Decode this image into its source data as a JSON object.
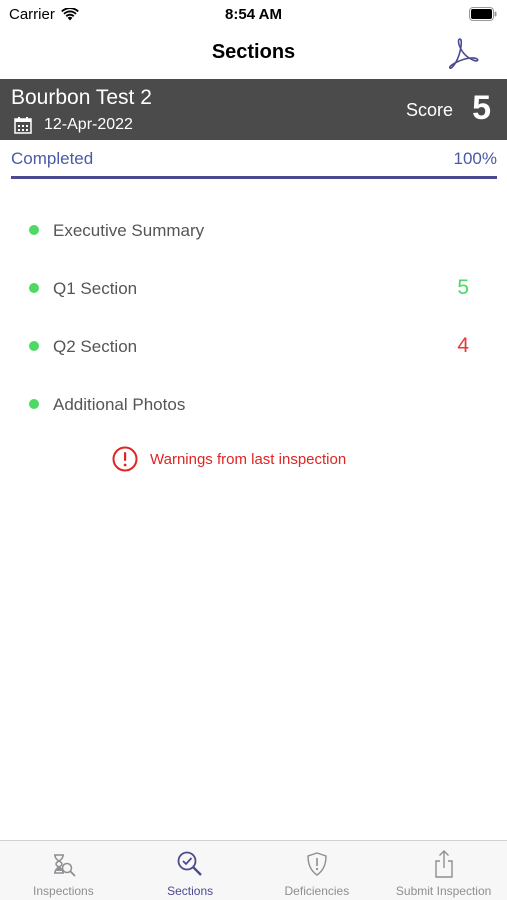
{
  "status_bar": {
    "carrier": "Carrier",
    "time": "8:54 AM"
  },
  "nav": {
    "title": "Sections",
    "pdf_icon": "pdf-icon"
  },
  "inspection": {
    "name": "Bourbon Test 2",
    "date": "12-Apr-2022",
    "score_label": "Score",
    "score_value": "5"
  },
  "progress": {
    "label": "Completed",
    "percent_text": "100%",
    "fraction": 1.0
  },
  "sections": [
    {
      "label": "Executive Summary",
      "score": "",
      "score_color": "#4cd964"
    },
    {
      "label": "Q1 Section",
      "score": "5",
      "score_color": "#4cd964"
    },
    {
      "label": "Q2 Section",
      "score": "4",
      "score_color": "#e53935"
    },
    {
      "label": "Additional Photos",
      "score": "",
      "score_color": "#4cd964"
    }
  ],
  "warning": {
    "text": "Warnings from last inspection",
    "color": "#e02424"
  },
  "tabs": [
    {
      "label": "Inspections",
      "icon": "hourglass-search-icon",
      "active": false
    },
    {
      "label": "Sections",
      "icon": "check-search-icon",
      "active": true
    },
    {
      "label": "Deficiencies",
      "icon": "shield-alert-icon",
      "active": false
    },
    {
      "label": "Submit Inspection",
      "icon": "share-icon",
      "active": false
    }
  ],
  "colors": {
    "accent": "#4b4a8f",
    "header_bg": "#4b4b4b",
    "dot_green": "#4cd964"
  }
}
